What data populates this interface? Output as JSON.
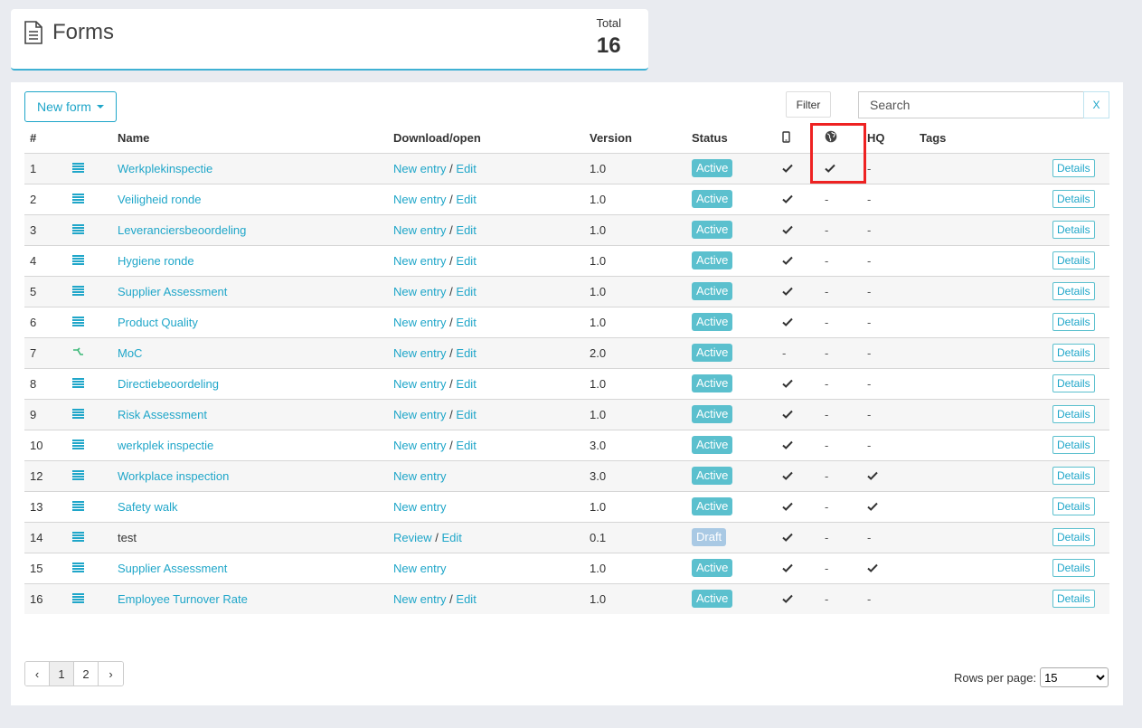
{
  "header": {
    "title": "Forms",
    "total_label": "Total",
    "total_value": "16"
  },
  "toolbar": {
    "new_form_label": "New form",
    "filter_label": "Filter",
    "search_placeholder": "Search",
    "clear_label": "X"
  },
  "columns": {
    "num": "#",
    "name": "Name",
    "download": "Download/open",
    "version": "Version",
    "status": "Status",
    "hq": "HQ",
    "tags": "Tags"
  },
  "colors": {
    "accent": "#1fa6c9",
    "active": "#5bc0ce",
    "draft": "#a9c9e4",
    "highlight": "#e22222"
  },
  "rows": [
    {
      "num": "1",
      "icon": "list-icon",
      "name": "Werkplekinspectie",
      "name_link": true,
      "primary": "New entry",
      "edit": "Edit",
      "version": "1.0",
      "status": "Active",
      "mobile": true,
      "globe": true,
      "hq": false,
      "details": "Details"
    },
    {
      "num": "2",
      "icon": "list-icon",
      "name": "Veiligheid ronde",
      "name_link": true,
      "primary": "New entry",
      "edit": "Edit",
      "version": "1.0",
      "status": "Active",
      "mobile": true,
      "globe": false,
      "hq": false,
      "details": "Details"
    },
    {
      "num": "3",
      "icon": "list-icon",
      "name": "Leveranciersbeoordeling",
      "name_link": true,
      "primary": "New entry",
      "edit": "Edit",
      "version": "1.0",
      "status": "Active",
      "mobile": true,
      "globe": false,
      "hq": false,
      "details": "Details"
    },
    {
      "num": "4",
      "icon": "list-icon",
      "name": "Hygiene ronde",
      "name_link": true,
      "primary": "New entry",
      "edit": "Edit",
      "version": "1.0",
      "status": "Active",
      "mobile": true,
      "globe": false,
      "hq": false,
      "details": "Details"
    },
    {
      "num": "5",
      "icon": "list-icon",
      "name": "Supplier Assessment",
      "name_link": true,
      "primary": "New entry",
      "edit": "Edit",
      "version": "1.0",
      "status": "Active",
      "mobile": true,
      "globe": false,
      "hq": false,
      "details": "Details"
    },
    {
      "num": "6",
      "icon": "list-icon",
      "name": "Product Quality",
      "name_link": true,
      "primary": "New entry",
      "edit": "Edit",
      "version": "1.0",
      "status": "Active",
      "mobile": true,
      "globe": false,
      "hq": false,
      "details": "Details"
    },
    {
      "num": "7",
      "icon": "flow-icon",
      "name": "MoC",
      "name_link": true,
      "primary": "New entry",
      "edit": "Edit",
      "version": "2.0",
      "status": "Active",
      "mobile": false,
      "globe": false,
      "hq": false,
      "details": "Details"
    },
    {
      "num": "8",
      "icon": "list-icon",
      "name": "Directiebeoordeling",
      "name_link": true,
      "primary": "New entry",
      "edit": "Edit",
      "version": "1.0",
      "status": "Active",
      "mobile": true,
      "globe": false,
      "hq": false,
      "details": "Details"
    },
    {
      "num": "9",
      "icon": "list-icon",
      "name": "Risk Assessment",
      "name_link": true,
      "primary": "New entry",
      "edit": "Edit",
      "version": "1.0",
      "status": "Active",
      "mobile": true,
      "globe": false,
      "hq": false,
      "details": "Details"
    },
    {
      "num": "10",
      "icon": "list-icon",
      "name": "werkplek inspectie",
      "name_link": true,
      "primary": "New entry",
      "edit": "Edit",
      "version": "3.0",
      "status": "Active",
      "mobile": true,
      "globe": false,
      "hq": false,
      "details": "Details"
    },
    {
      "num": "12",
      "icon": "list-icon",
      "name": "Workplace inspection",
      "name_link": true,
      "primary": "New entry",
      "edit": "",
      "version": "3.0",
      "status": "Active",
      "mobile": true,
      "globe": false,
      "hq": true,
      "details": "Details"
    },
    {
      "num": "13",
      "icon": "list-icon",
      "name": "Safety walk",
      "name_link": true,
      "primary": "New entry",
      "edit": "",
      "version": "1.0",
      "status": "Active",
      "mobile": true,
      "globe": false,
      "hq": true,
      "details": "Details"
    },
    {
      "num": "14",
      "icon": "list-icon",
      "name": "test",
      "name_link": false,
      "primary": "Review",
      "edit": "Edit",
      "version": "0.1",
      "status": "Draft",
      "mobile": true,
      "globe": false,
      "hq": false,
      "details": "Details"
    },
    {
      "num": "15",
      "icon": "list-icon",
      "name": "Supplier Assessment",
      "name_link": true,
      "primary": "New entry",
      "edit": "",
      "version": "1.0",
      "status": "Active",
      "mobile": true,
      "globe": false,
      "hq": true,
      "details": "Details"
    },
    {
      "num": "16",
      "icon": "list-icon",
      "name": "Employee Turnover Rate",
      "name_link": true,
      "primary": "New entry",
      "edit": "Edit",
      "version": "1.0",
      "status": "Active",
      "mobile": true,
      "globe": false,
      "hq": false,
      "details": "Details"
    }
  ],
  "pagination": {
    "prev": "‹",
    "pages": [
      "1",
      "2"
    ],
    "current": "1",
    "next": "›"
  },
  "rows_per_page": {
    "label": "Rows per page:",
    "value": "15"
  }
}
